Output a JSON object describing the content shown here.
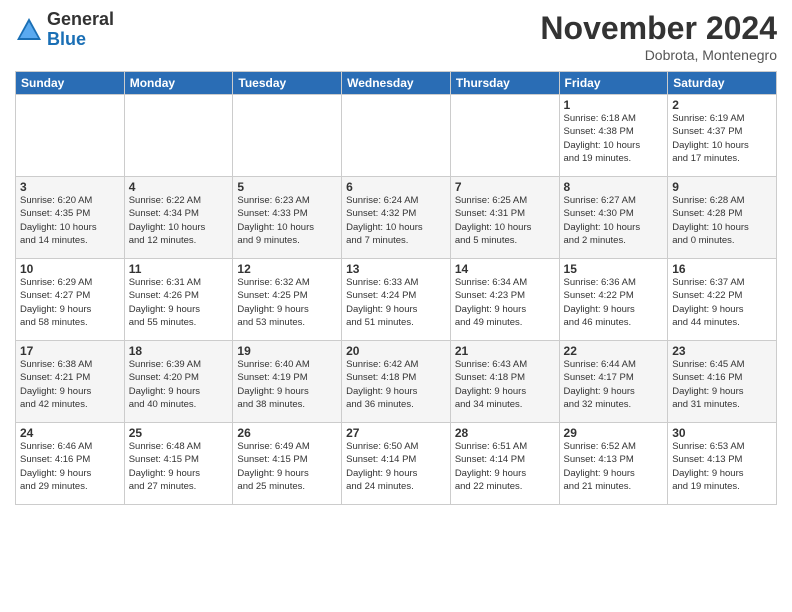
{
  "logo": {
    "general": "General",
    "blue": "Blue"
  },
  "title": "November 2024",
  "location": "Dobrota, Montenegro",
  "days_header": [
    "Sunday",
    "Monday",
    "Tuesday",
    "Wednesday",
    "Thursday",
    "Friday",
    "Saturday"
  ],
  "weeks": [
    [
      {
        "day": "",
        "info": ""
      },
      {
        "day": "",
        "info": ""
      },
      {
        "day": "",
        "info": ""
      },
      {
        "day": "",
        "info": ""
      },
      {
        "day": "",
        "info": ""
      },
      {
        "day": "1",
        "info": "Sunrise: 6:18 AM\nSunset: 4:38 PM\nDaylight: 10 hours\nand 19 minutes."
      },
      {
        "day": "2",
        "info": "Sunrise: 6:19 AM\nSunset: 4:37 PM\nDaylight: 10 hours\nand 17 minutes."
      }
    ],
    [
      {
        "day": "3",
        "info": "Sunrise: 6:20 AM\nSunset: 4:35 PM\nDaylight: 10 hours\nand 14 minutes."
      },
      {
        "day": "4",
        "info": "Sunrise: 6:22 AM\nSunset: 4:34 PM\nDaylight: 10 hours\nand 12 minutes."
      },
      {
        "day": "5",
        "info": "Sunrise: 6:23 AM\nSunset: 4:33 PM\nDaylight: 10 hours\nand 9 minutes."
      },
      {
        "day": "6",
        "info": "Sunrise: 6:24 AM\nSunset: 4:32 PM\nDaylight: 10 hours\nand 7 minutes."
      },
      {
        "day": "7",
        "info": "Sunrise: 6:25 AM\nSunset: 4:31 PM\nDaylight: 10 hours\nand 5 minutes."
      },
      {
        "day": "8",
        "info": "Sunrise: 6:27 AM\nSunset: 4:30 PM\nDaylight: 10 hours\nand 2 minutes."
      },
      {
        "day": "9",
        "info": "Sunrise: 6:28 AM\nSunset: 4:28 PM\nDaylight: 10 hours\nand 0 minutes."
      }
    ],
    [
      {
        "day": "10",
        "info": "Sunrise: 6:29 AM\nSunset: 4:27 PM\nDaylight: 9 hours\nand 58 minutes."
      },
      {
        "day": "11",
        "info": "Sunrise: 6:31 AM\nSunset: 4:26 PM\nDaylight: 9 hours\nand 55 minutes."
      },
      {
        "day": "12",
        "info": "Sunrise: 6:32 AM\nSunset: 4:25 PM\nDaylight: 9 hours\nand 53 minutes."
      },
      {
        "day": "13",
        "info": "Sunrise: 6:33 AM\nSunset: 4:24 PM\nDaylight: 9 hours\nand 51 minutes."
      },
      {
        "day": "14",
        "info": "Sunrise: 6:34 AM\nSunset: 4:23 PM\nDaylight: 9 hours\nand 49 minutes."
      },
      {
        "day": "15",
        "info": "Sunrise: 6:36 AM\nSunset: 4:22 PM\nDaylight: 9 hours\nand 46 minutes."
      },
      {
        "day": "16",
        "info": "Sunrise: 6:37 AM\nSunset: 4:22 PM\nDaylight: 9 hours\nand 44 minutes."
      }
    ],
    [
      {
        "day": "17",
        "info": "Sunrise: 6:38 AM\nSunset: 4:21 PM\nDaylight: 9 hours\nand 42 minutes."
      },
      {
        "day": "18",
        "info": "Sunrise: 6:39 AM\nSunset: 4:20 PM\nDaylight: 9 hours\nand 40 minutes."
      },
      {
        "day": "19",
        "info": "Sunrise: 6:40 AM\nSunset: 4:19 PM\nDaylight: 9 hours\nand 38 minutes."
      },
      {
        "day": "20",
        "info": "Sunrise: 6:42 AM\nSunset: 4:18 PM\nDaylight: 9 hours\nand 36 minutes."
      },
      {
        "day": "21",
        "info": "Sunrise: 6:43 AM\nSunset: 4:18 PM\nDaylight: 9 hours\nand 34 minutes."
      },
      {
        "day": "22",
        "info": "Sunrise: 6:44 AM\nSunset: 4:17 PM\nDaylight: 9 hours\nand 32 minutes."
      },
      {
        "day": "23",
        "info": "Sunrise: 6:45 AM\nSunset: 4:16 PM\nDaylight: 9 hours\nand 31 minutes."
      }
    ],
    [
      {
        "day": "24",
        "info": "Sunrise: 6:46 AM\nSunset: 4:16 PM\nDaylight: 9 hours\nand 29 minutes."
      },
      {
        "day": "25",
        "info": "Sunrise: 6:48 AM\nSunset: 4:15 PM\nDaylight: 9 hours\nand 27 minutes."
      },
      {
        "day": "26",
        "info": "Sunrise: 6:49 AM\nSunset: 4:15 PM\nDaylight: 9 hours\nand 25 minutes."
      },
      {
        "day": "27",
        "info": "Sunrise: 6:50 AM\nSunset: 4:14 PM\nDaylight: 9 hours\nand 24 minutes."
      },
      {
        "day": "28",
        "info": "Sunrise: 6:51 AM\nSunset: 4:14 PM\nDaylight: 9 hours\nand 22 minutes."
      },
      {
        "day": "29",
        "info": "Sunrise: 6:52 AM\nSunset: 4:13 PM\nDaylight: 9 hours\nand 21 minutes."
      },
      {
        "day": "30",
        "info": "Sunrise: 6:53 AM\nSunset: 4:13 PM\nDaylight: 9 hours\nand 19 minutes."
      }
    ]
  ]
}
